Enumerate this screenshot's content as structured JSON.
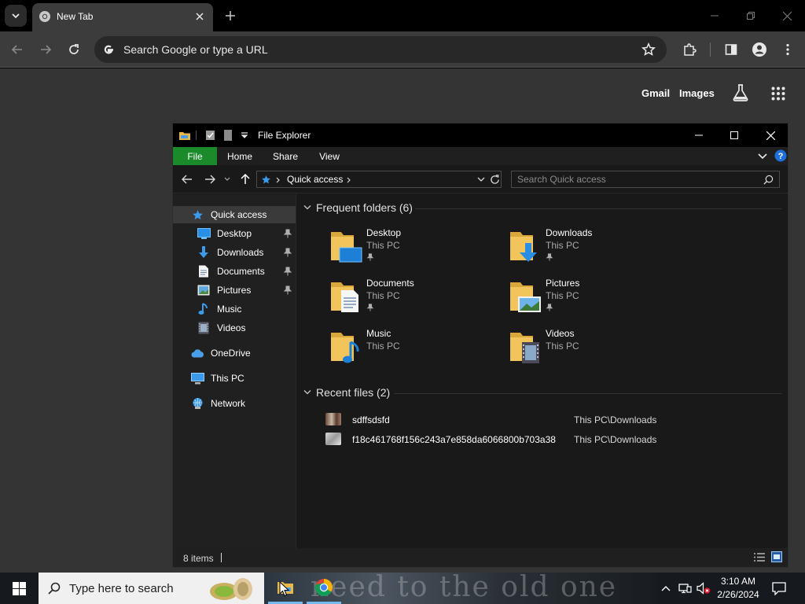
{
  "browser": {
    "tab_title": "New Tab",
    "omnibox_placeholder": "Search Google or type a URL",
    "ntp_links": {
      "gmail": "Gmail",
      "images": "Images"
    }
  },
  "explorer": {
    "title": "File Explorer",
    "ribbon_tabs": [
      "File",
      "Home",
      "Share",
      "View"
    ],
    "address": "Quick access",
    "search_placeholder": "Search Quick access",
    "sidebar": [
      {
        "label": "Quick access",
        "icon": "star-icon",
        "pinned": false
      },
      {
        "label": "Desktop",
        "icon": "desktop-icon",
        "pinned": true
      },
      {
        "label": "Downloads",
        "icon": "download-icon",
        "pinned": true
      },
      {
        "label": "Documents",
        "icon": "document-icon",
        "pinned": true
      },
      {
        "label": "Pictures",
        "icon": "picture-icon",
        "pinned": true
      },
      {
        "label": "Music",
        "icon": "music-icon",
        "pinned": false
      },
      {
        "label": "Videos",
        "icon": "video-icon",
        "pinned": false
      },
      {
        "label": "OneDrive",
        "icon": "cloud-icon",
        "pinned": false
      },
      {
        "label": "This PC",
        "icon": "computer-icon",
        "pinned": false
      },
      {
        "label": "Network",
        "icon": "network-icon",
        "pinned": false
      }
    ],
    "frequent_header": "Frequent folders (6)",
    "frequent_folders": [
      {
        "name": "Desktop",
        "location": "This PC",
        "pinned": true
      },
      {
        "name": "Downloads",
        "location": "This PC",
        "pinned": true
      },
      {
        "name": "Documents",
        "location": "This PC",
        "pinned": true
      },
      {
        "name": "Pictures",
        "location": "This PC",
        "pinned": true
      },
      {
        "name": "Music",
        "location": "This PC",
        "pinned": false
      },
      {
        "name": "Videos",
        "location": "This PC",
        "pinned": false
      }
    ],
    "recent_header": "Recent files (2)",
    "recent_files": [
      {
        "name": "sdffsdsfd",
        "location": "This PC\\Downloads"
      },
      {
        "name": "f18c461768f156c243a7e858da6066800b703a38",
        "location": "This PC\\Downloads"
      }
    ],
    "status": "8 items"
  },
  "taskbar": {
    "search_placeholder": "Type here to search",
    "time": "3:10 AM",
    "date": "2/26/2024",
    "wallpaper_text": "need to the old one"
  },
  "colors": {
    "file_tab": "#1a8a2a",
    "help": "#1e6fd9",
    "taskbar_active": "#76b9ed"
  }
}
